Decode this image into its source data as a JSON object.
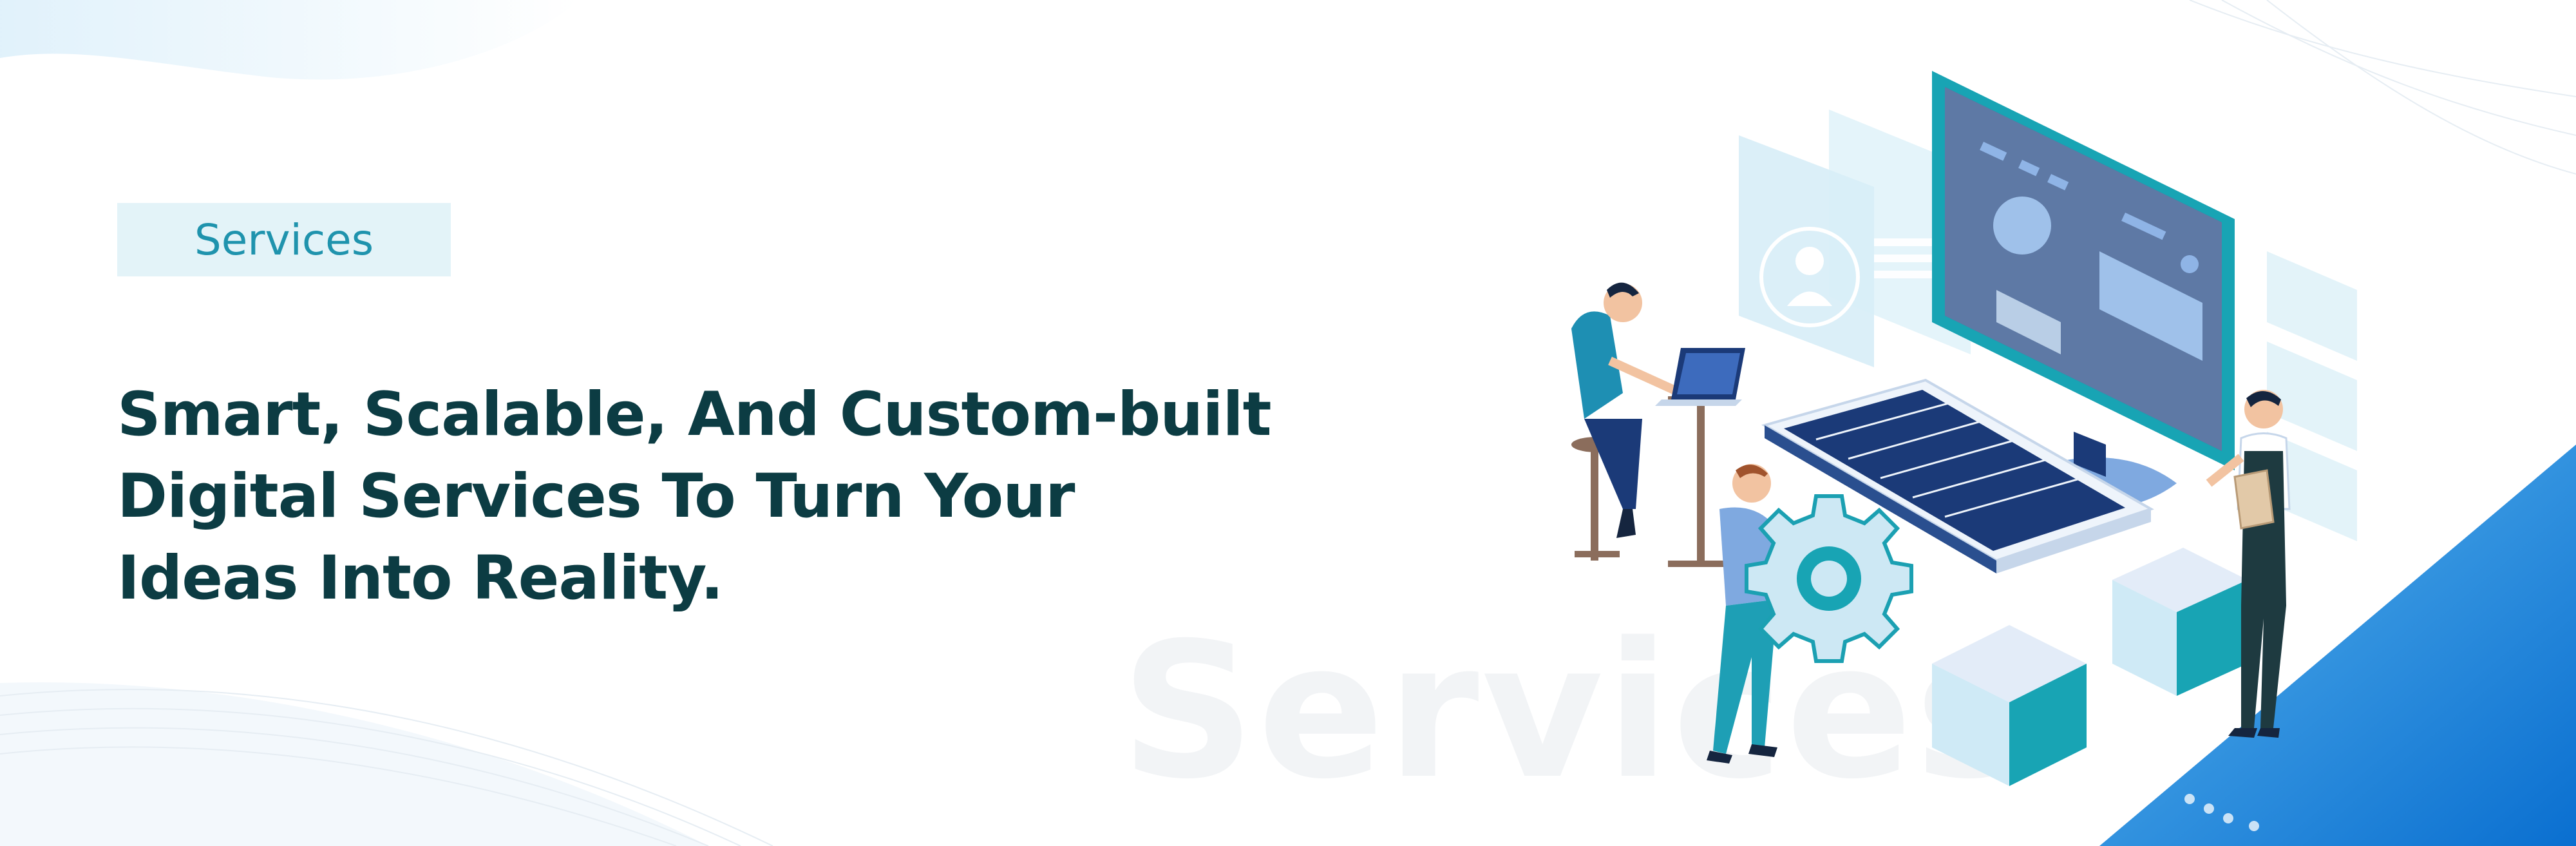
{
  "banner": {
    "tag_label": "Services",
    "headline_lines": [
      "Smart, Scalable, And Custom-built",
      "Digital Services To Turn Your",
      "Ideas Into Reality."
    ],
    "watermark_text": "Services"
  },
  "colors": {
    "headline": "#0c3c43",
    "tag_text": "#1f93ad",
    "tag_background": "#e3f3f8",
    "accent_blue": "#1888d8",
    "teal": "#18a4b4",
    "navy": "#1b3a78"
  },
  "illustration": {
    "icons": [
      "computer-monitor-icon",
      "keyboard-icon",
      "laptop-icon",
      "gear-icon",
      "user-profile-icon",
      "clipboard-icon",
      "cube-icon"
    ]
  }
}
